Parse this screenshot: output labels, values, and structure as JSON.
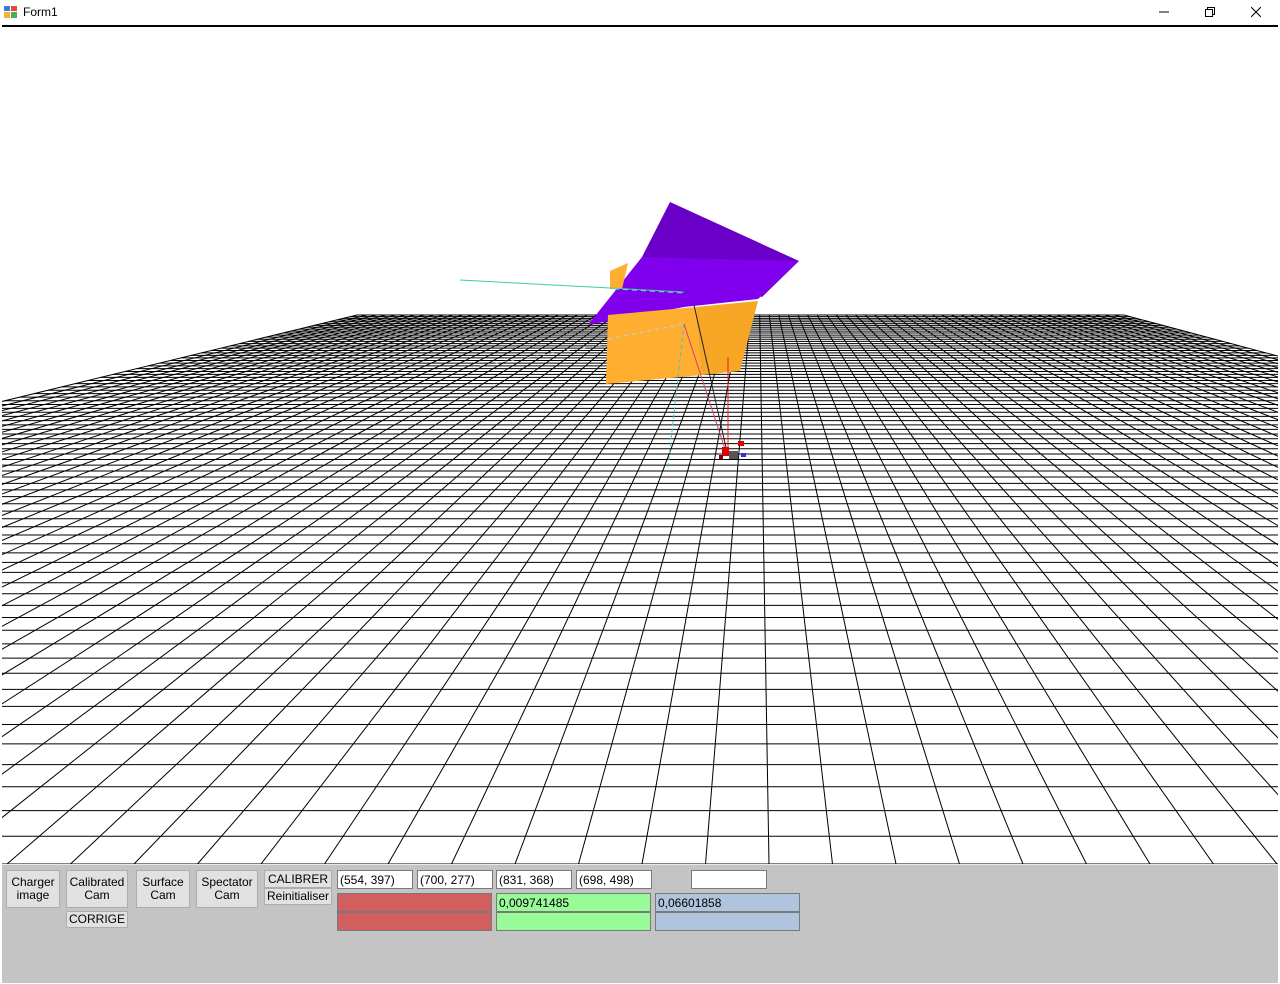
{
  "window": {
    "title": "Form1",
    "minimize_glyph": "—",
    "restore_glyph": "❐",
    "close_glyph": "✕",
    "icon": "winforms-app-icon"
  },
  "colors": {
    "grid_line": "#000000",
    "prism_purple": "#8000ee",
    "prism_purple_dark": "#6a00c8",
    "box_orange": "#ffae2f",
    "panel_bg": "#c4c4c4",
    "field_red": "#d25f5f",
    "field_green": "#98fb98",
    "field_blue": "#b0c4de"
  },
  "controls": {
    "charger_image": "Charger\nimage",
    "calibrated_cam": "Calibrated\nCam",
    "surface_cam": "Surface\nCam",
    "spectator_cam": "Spectator\nCam",
    "calibrer": "CALIBRER",
    "reinitialiser": "Reinitialiser",
    "corrige": "CORRIGE"
  },
  "points": [
    "(554, 397)",
    "(700, 277)",
    "(831, 368)",
    "(698, 498)"
  ],
  "fields": {
    "top_extra": "",
    "red_1": "",
    "red_2": "",
    "green_1": "0,009741485",
    "green_2": "",
    "blue_1": "0,06601858",
    "blue_2": ""
  }
}
